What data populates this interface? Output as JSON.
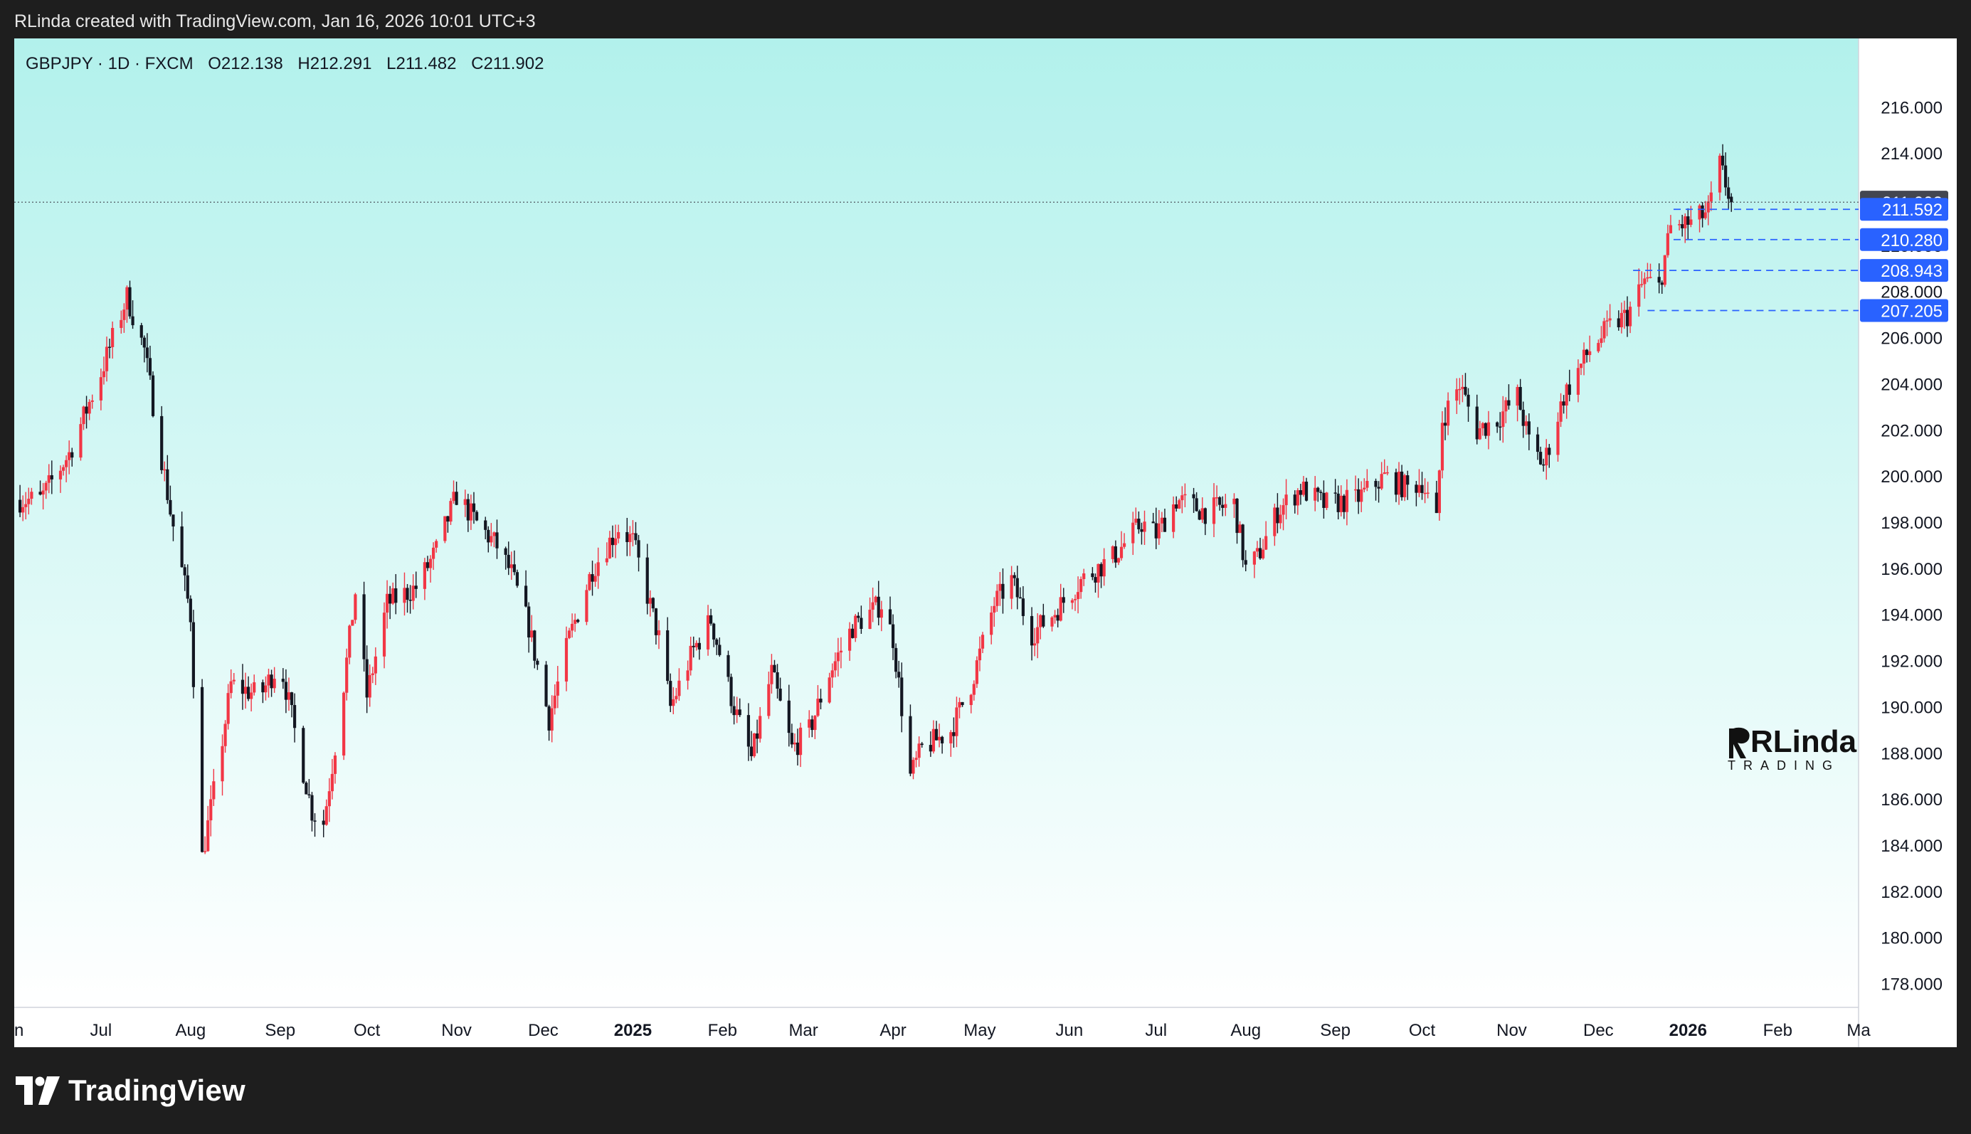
{
  "header": {
    "credit": "RLinda created with TradingView.com, Jan 16, 2026 10:01 UTC+3"
  },
  "legend": {
    "symbol": "GBPJPY · 1D · FXCM",
    "open": "O212.138",
    "high": "H212.291",
    "low": "L211.482",
    "close": "C211.902"
  },
  "footer": {
    "brand": "TradingView"
  },
  "watermark": {
    "title": "RLinda",
    "subtitle": "TRADING"
  },
  "colors": {
    "bg_top": "#b2f1ec",
    "bg_bottom": "#ffffff",
    "up": "#f23645",
    "down": "#131722",
    "level": "#2962ff",
    "last_price_bg": "#434651"
  },
  "chart_data": {
    "type": "candlestick",
    "symbol": "GBPJPY",
    "timeframe": "1D",
    "ylim": [
      177,
      219
    ],
    "y_ticks": [
      "178.000",
      "180.000",
      "182.000",
      "184.000",
      "186.000",
      "188.000",
      "190.000",
      "192.000",
      "194.000",
      "196.000",
      "198.000",
      "200.000",
      "202.000",
      "204.000",
      "206.000",
      "208.000",
      "210.000",
      "212.000",
      "214.000",
      "216.000"
    ],
    "x_ticks": [
      {
        "label": "un",
        "date": "2024-06-01"
      },
      {
        "label": "Jul",
        "date": "2024-07-01"
      },
      {
        "label": "Aug",
        "date": "2024-08-01"
      },
      {
        "label": "Sep",
        "date": "2024-09-01"
      },
      {
        "label": "Oct",
        "date": "2024-10-01"
      },
      {
        "label": "Nov",
        "date": "2024-11-01"
      },
      {
        "label": "Dec",
        "date": "2024-12-01"
      },
      {
        "label": "2025",
        "date": "2025-01-01",
        "bold": true
      },
      {
        "label": "Feb",
        "date": "2025-02-01"
      },
      {
        "label": "Mar",
        "date": "2025-03-01"
      },
      {
        "label": "Apr",
        "date": "2025-04-01"
      },
      {
        "label": "May",
        "date": "2025-05-01"
      },
      {
        "label": "Jun",
        "date": "2025-06-01"
      },
      {
        "label": "Jul",
        "date": "2025-07-01"
      },
      {
        "label": "Aug",
        "date": "2025-08-01"
      },
      {
        "label": "Sep",
        "date": "2025-09-01"
      },
      {
        "label": "Oct",
        "date": "2025-10-01"
      },
      {
        "label": "Nov",
        "date": "2025-11-01"
      },
      {
        "label": "Dec",
        "date": "2025-12-01"
      },
      {
        "label": "2026",
        "date": "2026-01-01",
        "bold": true
      },
      {
        "label": "Feb",
        "date": "2026-02-01"
      },
      {
        "label": "Ma",
        "date": "2026-03-01"
      }
    ],
    "x_range": [
      "2024-06-01",
      "2026-03-01"
    ],
    "price_path": [
      [
        "2024-06-01",
        199.0
      ],
      [
        "2024-06-10",
        199.0
      ],
      [
        "2024-06-20",
        201.0
      ],
      [
        "2024-07-01",
        204.5
      ],
      [
        "2024-07-10",
        207.8
      ],
      [
        "2024-07-16",
        205.5
      ],
      [
        "2024-07-25",
        198.5
      ],
      [
        "2024-08-01",
        194.0
      ],
      [
        "2024-08-05",
        183.5
      ],
      [
        "2024-08-10",
        187.0
      ],
      [
        "2024-08-15",
        191.0
      ],
      [
        "2024-08-25",
        190.5
      ],
      [
        "2024-09-01",
        192.0
      ],
      [
        "2024-09-06",
        189.0
      ],
      [
        "2024-09-12",
        185.5
      ],
      [
        "2024-09-16",
        185.0
      ],
      [
        "2024-09-22",
        190.0
      ],
      [
        "2024-09-27",
        195.0
      ],
      [
        "2024-10-01",
        190.5
      ],
      [
        "2024-10-08",
        194.5
      ],
      [
        "2024-10-18",
        195.2
      ],
      [
        "2024-10-25",
        196.8
      ],
      [
        "2024-11-01",
        199.2
      ],
      [
        "2024-11-08",
        198.0
      ],
      [
        "2024-11-15",
        197.0
      ],
      [
        "2024-11-20",
        195.8
      ],
      [
        "2024-11-26",
        193.5
      ],
      [
        "2024-12-03",
        189.5
      ],
      [
        "2024-12-10",
        193.0
      ],
      [
        "2024-12-18",
        196.0
      ],
      [
        "2024-12-27",
        197.8
      ],
      [
        "2025-01-01",
        197.2
      ],
      [
        "2025-01-10",
        193.0
      ],
      [
        "2025-01-14",
        190.0
      ],
      [
        "2025-01-22",
        192.5
      ],
      [
        "2025-01-28",
        193.8
      ],
      [
        "2025-02-05",
        190.0
      ],
      [
        "2025-02-11",
        187.8
      ],
      [
        "2025-02-18",
        191.5
      ],
      [
        "2025-02-25",
        188.2
      ],
      [
        "2025-03-03",
        189.0
      ],
      [
        "2025-03-10",
        191.5
      ],
      [
        "2025-03-18",
        193.5
      ],
      [
        "2025-03-28",
        194.5
      ],
      [
        "2025-04-01",
        193.0
      ],
      [
        "2025-04-07",
        187.0
      ],
      [
        "2025-04-11",
        188.2
      ],
      [
        "2025-04-21",
        189.0
      ],
      [
        "2025-04-28",
        191.0
      ],
      [
        "2025-05-06",
        194.5
      ],
      [
        "2025-05-12",
        195.5
      ],
      [
        "2025-05-19",
        193.2
      ],
      [
        "2025-05-26",
        194.0
      ],
      [
        "2025-06-05",
        195.5
      ],
      [
        "2025-06-16",
        196.5
      ],
      [
        "2025-06-26",
        198.0
      ],
      [
        "2025-07-01",
        197.5
      ],
      [
        "2025-07-08",
        199.0
      ],
      [
        "2025-07-18",
        198.5
      ],
      [
        "2025-07-28",
        198.8
      ],
      [
        "2025-08-01",
        196.0
      ],
      [
        "2025-08-05",
        196.5
      ],
      [
        "2025-08-12",
        198.5
      ],
      [
        "2025-08-20",
        199.5
      ],
      [
        "2025-08-28",
        198.8
      ],
      [
        "2025-09-08",
        199.0
      ],
      [
        "2025-09-18",
        200.0
      ],
      [
        "2025-09-26",
        199.5
      ],
      [
        "2025-10-01",
        199.8
      ],
      [
        "2025-10-06",
        198.0
      ],
      [
        "2025-10-08",
        202.5
      ],
      [
        "2025-10-14",
        204.0
      ],
      [
        "2025-10-20",
        202.0
      ],
      [
        "2025-10-27",
        202.5
      ],
      [
        "2025-11-03",
        203.5
      ],
      [
        "2025-11-07",
        201.5
      ],
      [
        "2025-11-12",
        200.5
      ],
      [
        "2025-11-19",
        203.5
      ],
      [
        "2025-11-28",
        205.5
      ],
      [
        "2025-12-05",
        206.5
      ],
      [
        "2025-12-11",
        207.0
      ],
      [
        "2025-12-17",
        208.5
      ],
      [
        "2025-12-22",
        208.2
      ],
      [
        "2025-12-26",
        210.8
      ],
      [
        "2026-01-02",
        211.0
      ],
      [
        "2026-01-08",
        211.5
      ],
      [
        "2026-01-12",
        213.5
      ],
      [
        "2026-01-16",
        211.9
      ]
    ],
    "levels": [
      {
        "price": 211.592,
        "label": "211.592",
        "from": "2025-12-27"
      },
      {
        "price": 210.28,
        "label": "210.280",
        "from": "2025-12-27"
      },
      {
        "price": 208.943,
        "label": "208.943",
        "from": "2025-12-13"
      },
      {
        "price": 207.205,
        "label": "207.205",
        "from": "2025-12-18"
      }
    ],
    "last_price": {
      "price": 211.902,
      "label": "211.902"
    }
  }
}
